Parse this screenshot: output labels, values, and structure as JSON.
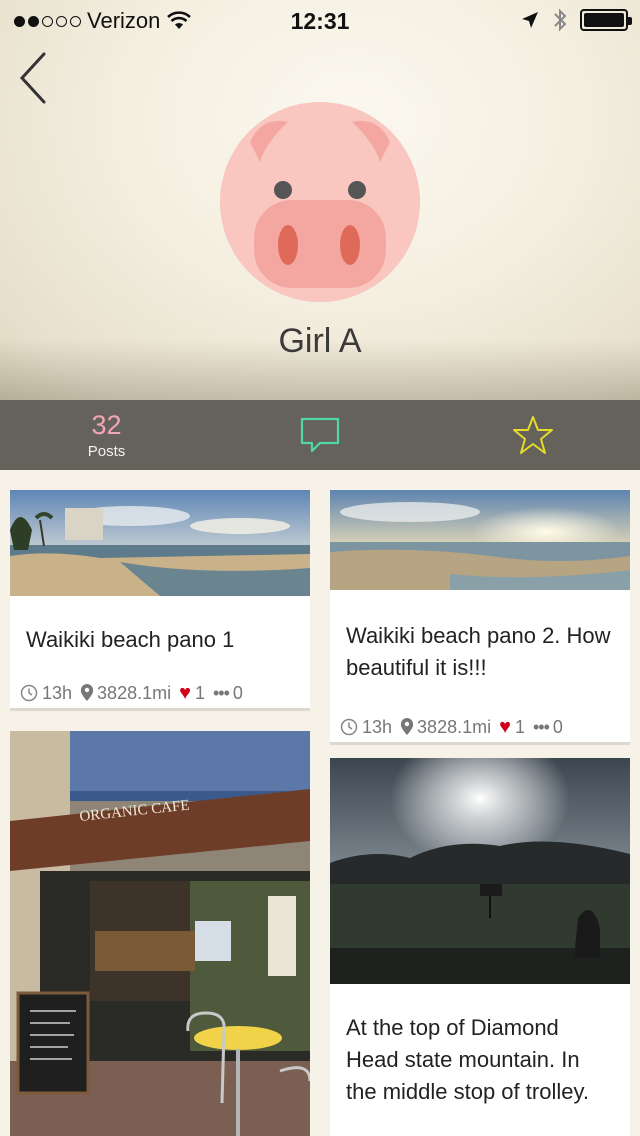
{
  "status_bar": {
    "carrier": "Verizon",
    "time": "12:31"
  },
  "profile": {
    "name": "Girl A"
  },
  "tabs": {
    "posts_count": "32",
    "posts_label": "Posts"
  },
  "colors": {
    "tab_bar_bg": "#64625b",
    "posts_count": "#f2a6b5",
    "comment_icon": "#52d6a8",
    "star_icon": "#e6da2a",
    "avatar_face": "#f9c6c0",
    "heart": "#d0021b"
  },
  "posts": [
    {
      "title": "Waikiki beach pano 1",
      "age": "13h",
      "distance": "3828.1mi",
      "likes": "1",
      "comments": "0"
    },
    {
      "title": "Waikiki beach pano 2. How beautiful it is!!!",
      "age": "13h",
      "distance": "3828.1mi",
      "likes": "1",
      "comments": "0"
    },
    {
      "image_text": "ORGANIC CAFE"
    },
    {
      "title": "At the top of Diamond Head state mountain. In the middle stop of trolley."
    }
  ]
}
